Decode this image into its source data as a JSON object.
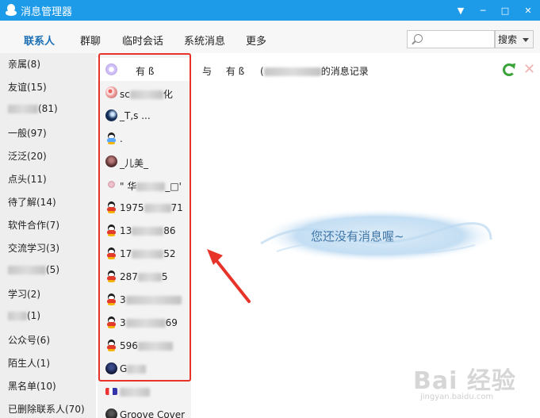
{
  "window": {
    "title": "消息管理器"
  },
  "tabs": [
    {
      "label": "联系人",
      "active": true
    },
    {
      "label": "群聊"
    },
    {
      "label": "临时会话"
    },
    {
      "label": "系统消息"
    },
    {
      "label": "更多"
    }
  ],
  "search": {
    "placeholder": "",
    "button_label": "搜索"
  },
  "groups": [
    {
      "label": "亲属(8)"
    },
    {
      "label": "友谊(15)"
    },
    {
      "label": "(81)"
    },
    {
      "label": "一般(97)"
    },
    {
      "label": "泛泛(20)"
    },
    {
      "label": "点头(11)"
    },
    {
      "label": "待了解(14)"
    },
    {
      "label": "软件合作(7)"
    },
    {
      "label": "交流学习(3)"
    },
    {
      "label": "(5)"
    },
    {
      "label": "学习(2)"
    },
    {
      "label": "(1)"
    },
    {
      "label": "公众号(6)"
    },
    {
      "label": "陌生人(1)"
    },
    {
      "label": "黑名单(10)"
    },
    {
      "label": "已删除联系人(70)"
    }
  ],
  "contacts": [
    {
      "name": "有  ß",
      "avatar": "flower-avatar",
      "selected": true
    },
    {
      "name": "sc",
      "suffix": "化",
      "avatar": "pattern-avatar"
    },
    {
      "name": "_T,s ...",
      "avatar": "night-avatar"
    },
    {
      "name": ".",
      "avatar": "qq-penguin-icon"
    },
    {
      "name": "_儿美_",
      "avatar": "photo-avatar"
    },
    {
      "name": "\" 华",
      "suffix": "_□'",
      "avatar": "small-avatar"
    },
    {
      "name": "1975",
      "suffix": "71",
      "avatar": "qq-penguin-icon"
    },
    {
      "name": "13",
      "suffix": "86",
      "avatar": "qq-penguin-icon"
    },
    {
      "name": "17",
      "suffix": "52",
      "avatar": "qq-penguin-icon"
    },
    {
      "name": "287",
      "suffix": "5",
      "avatar": "qq-penguin-icon"
    },
    {
      "name": "3",
      "suffix": "",
      "avatar": "qq-penguin-icon"
    },
    {
      "name": "3",
      "suffix": "69",
      "avatar": "qq-penguin-icon"
    },
    {
      "name": "596",
      "suffix": "",
      "avatar": "qq-penguin-icon"
    },
    {
      "name": "G",
      "suffix": "",
      "avatar": "dark-avatar"
    },
    {
      "name": "",
      "suffix": "",
      "avatar": "logo-avatar"
    },
    {
      "name": "Groove Cover",
      "avatar": "dark-avatar"
    }
  ],
  "main": {
    "header_with": "与",
    "header_name": "有  ß",
    "header_paren": "(",
    "header_suffix": "的消息记录",
    "empty_message": "您还没有消息喔~"
  },
  "watermark": {
    "brand": "Bai 经验",
    "url": "jingyan.baidu.com"
  },
  "colors": {
    "titlebar": "#1e9be8",
    "tab_active": "#1a6fb5",
    "highlight": "#e8332a",
    "refresh": "#3aa33a"
  }
}
